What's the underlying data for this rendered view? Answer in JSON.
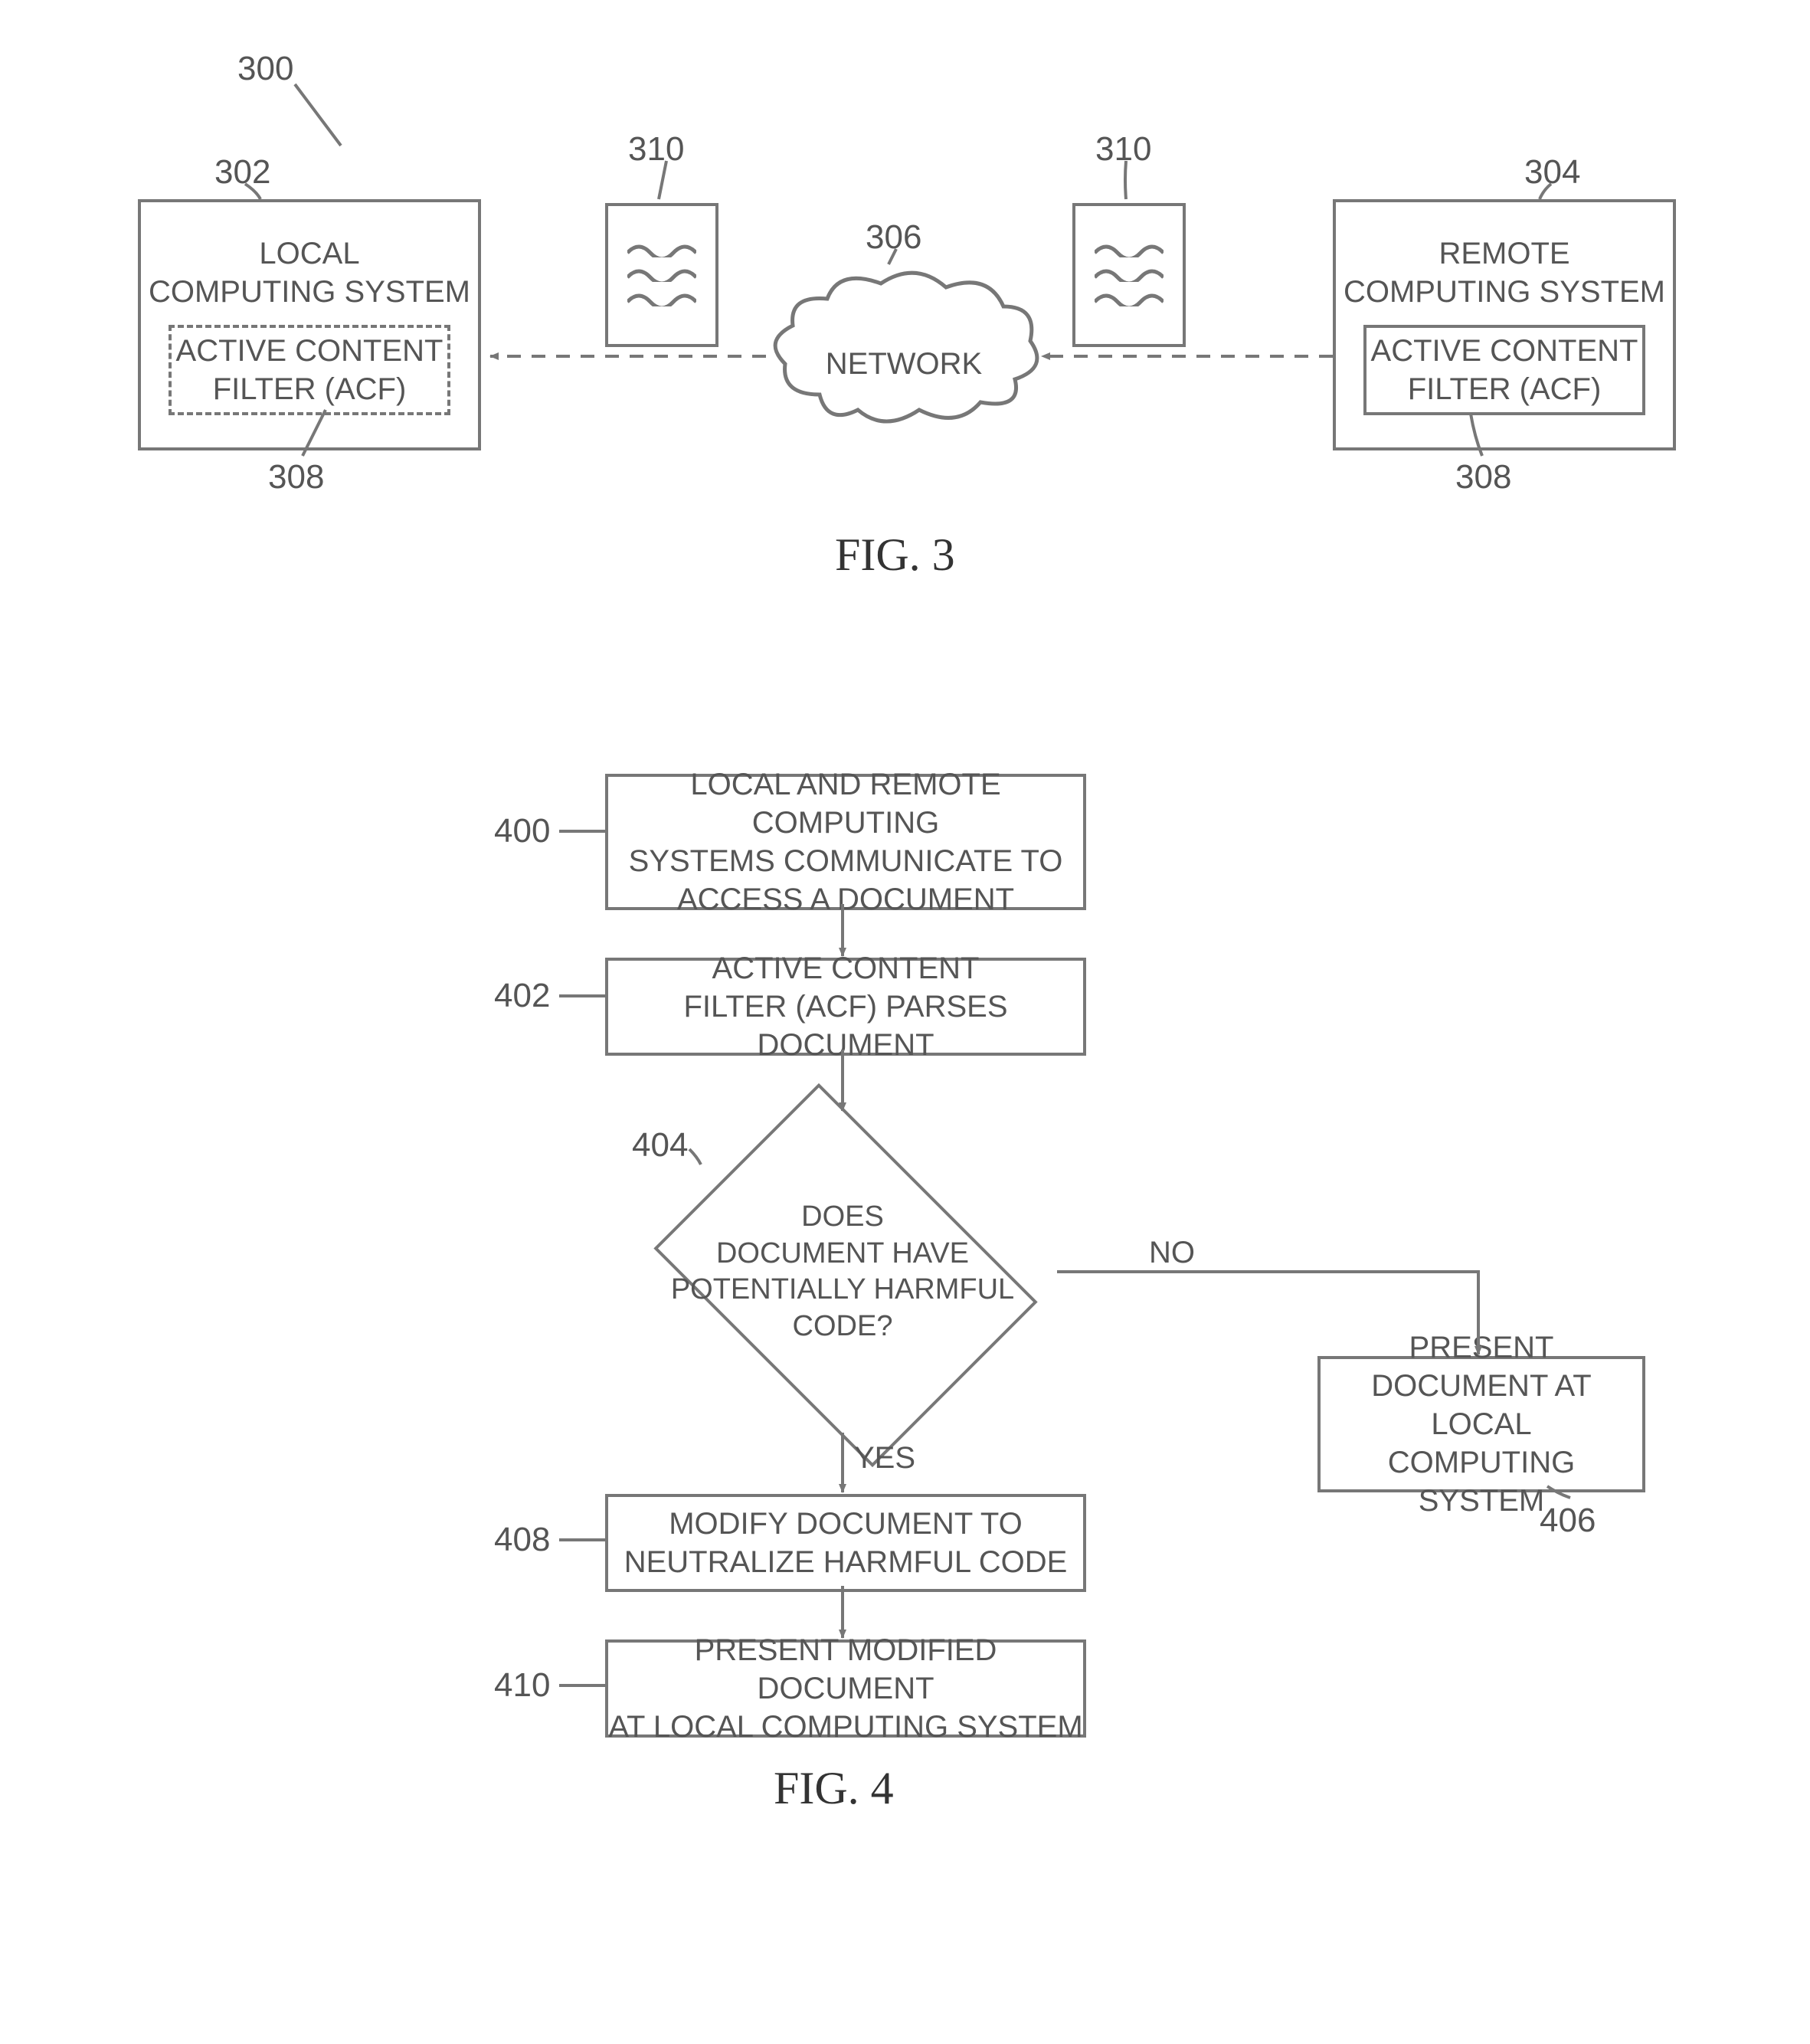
{
  "fig3": {
    "caption": "FIG. 3",
    "refDiagram": "300",
    "localSystem": {
      "ref": "302",
      "title": "LOCAL\nCOMPUTING SYSTEM",
      "acf": {
        "ref": "308",
        "label": "ACTIVE CONTENT\nFILTER (ACF)"
      }
    },
    "remoteSystem": {
      "ref": "304",
      "title": "REMOTE\nCOMPUTING SYSTEM",
      "acf": {
        "ref": "308",
        "label": "ACTIVE CONTENT\nFILTER (ACF)"
      }
    },
    "network": {
      "ref": "306",
      "label": "NETWORK"
    },
    "docLeft": {
      "ref": "310"
    },
    "docRight": {
      "ref": "310"
    }
  },
  "fig4": {
    "caption": "FIG. 4",
    "step400": {
      "ref": "400",
      "text": "LOCAL AND REMOTE COMPUTING\nSYSTEMS COMMUNICATE TO\nACCESS A DOCUMENT"
    },
    "step402": {
      "ref": "402",
      "text": "ACTIVE CONTENT\nFILTER (ACF) PARSES DOCUMENT"
    },
    "decision404": {
      "ref": "404",
      "text": "DOES\nDOCUMENT HAVE\nPOTENTIALLY HARMFUL\nCODE?",
      "yes": "YES",
      "no": "NO"
    },
    "step406": {
      "ref": "406",
      "text": "PRESENT\nDOCUMENT AT LOCAL\nCOMPUTING SYSTEM"
    },
    "step408": {
      "ref": "408",
      "text": "MODIFY DOCUMENT TO\nNEUTRALIZE HARMFUL CODE"
    },
    "step410": {
      "ref": "410",
      "text": "PRESENT MODIFIED DOCUMENT\nAT LOCAL COMPUTING SYSTEM"
    }
  }
}
